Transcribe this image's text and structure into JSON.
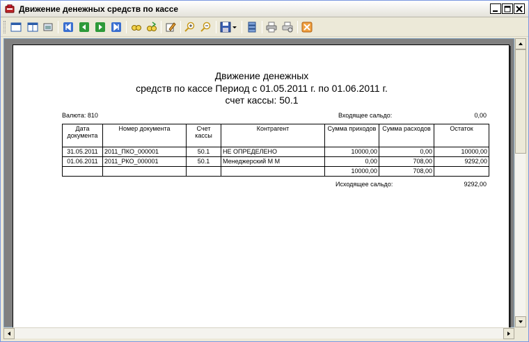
{
  "window": {
    "title": "Движение денежных средств по кассе"
  },
  "toolbar": {
    "icons": [
      "single-page-icon",
      "two-pages-icon",
      "page-setup-icon",
      "first-page-icon",
      "prev-page-icon",
      "next-page-icon",
      "last-page-icon",
      "find-icon",
      "find-next-icon",
      "edit-icon",
      "zoom-in-icon",
      "zoom-out-icon",
      "save-icon",
      "save-dropdown-icon",
      "export-icon",
      "print-icon",
      "print-setup-icon",
      "close-icon"
    ]
  },
  "report": {
    "title_line1": "Движение денежных",
    "title_line2": "средств по кассе Период с 01.05.2011 г. по 01.06.2011 г.",
    "title_line3": "счет кассы: 50.1",
    "currency_label": "Валюта: 810",
    "opening_label": "Входящее сальдо:",
    "opening_value": "0,00",
    "closing_label": "Исходящее сальдо:",
    "closing_value": "9292,00",
    "columns": [
      "Дата документа",
      "Номер документа",
      "Счет кассы",
      "Контрагент",
      "Сумма приходов",
      "Сумма расходов",
      "Остаток"
    ],
    "rows": [
      [
        "31.05.2011",
        "2011_ПКО_000001",
        "50.1",
        "НЕ ОПРЕДЕЛЕНО",
        "10000,00",
        "0,00",
        "10000,00"
      ],
      [
        "01.06.2011",
        "2011_РКО_000001",
        "50.1",
        "Менеджерский М М",
        "0,00",
        "708,00",
        "9292,00"
      ]
    ],
    "totals": {
      "income": "10000,00",
      "expense": "708,00"
    }
  }
}
